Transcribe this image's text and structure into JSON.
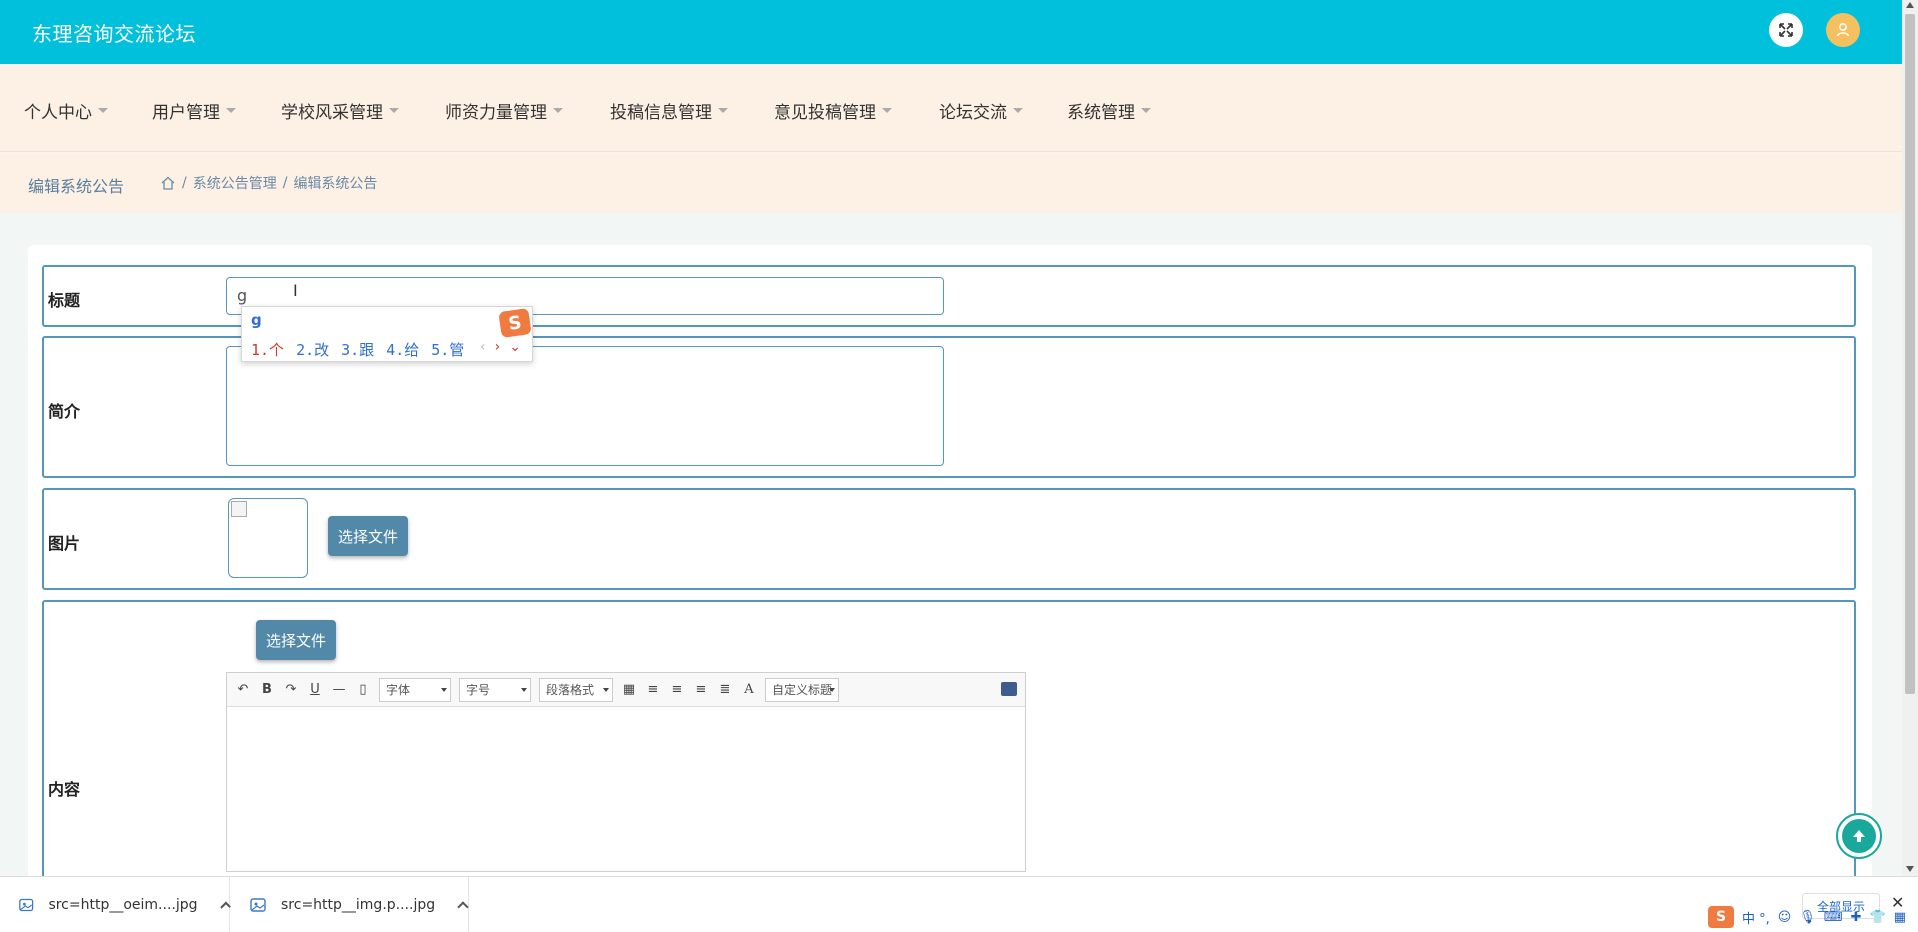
{
  "app": {
    "title": "东理咨询交流论坛"
  },
  "header": {
    "fullscreen_icon": "expand-icon",
    "avatar_icon": "user-icon"
  },
  "nav": {
    "items": [
      {
        "label": "个人中心"
      },
      {
        "label": "用户管理"
      },
      {
        "label": "学校风采管理"
      },
      {
        "label": "师资力量管理"
      },
      {
        "label": "投稿信息管理"
      },
      {
        "label": "意见投稿管理"
      },
      {
        "label": "论坛交流"
      },
      {
        "label": "系统管理"
      }
    ]
  },
  "breadcrumb": {
    "page_title": "编辑系统公告",
    "home_icon": "home-icon",
    "items": [
      "系统公告管理",
      "编辑系统公告"
    ],
    "separator": "/"
  },
  "form": {
    "title_label": "标题",
    "title_value": "g",
    "intro_label": "简介",
    "intro_value": "",
    "image_label": "图片",
    "image_button": "选择文件",
    "content_label": "内容",
    "content_button": "选择文件"
  },
  "ime": {
    "composition": "g",
    "candidates": [
      "1.个",
      "2.改",
      "3.跟",
      "4.给",
      "5.管"
    ],
    "prev": "‹",
    "next": "›",
    "expand": "⌄",
    "logo": "S"
  },
  "editor": {
    "selects": {
      "font": "字体",
      "size": "字号",
      "paragraph": "段落格式",
      "custom_title": "自定义标题"
    },
    "bold": "B",
    "underline": "U",
    "font_color": "A"
  },
  "downloads": {
    "items": [
      {
        "name": "src=http__oeim....jpg"
      },
      {
        "name": "src=http__img.p....jpg"
      }
    ],
    "show_all": "全部显示",
    "close": "✕"
  },
  "tray": {
    "logo": "S",
    "text": "中 °,"
  },
  "colors": {
    "header_bg": "#00c0dc",
    "nav_bg": "#fdf0e4",
    "row_border": "#5596bd",
    "button_bg": "#5289a9",
    "back_top": "#1aa89c"
  }
}
